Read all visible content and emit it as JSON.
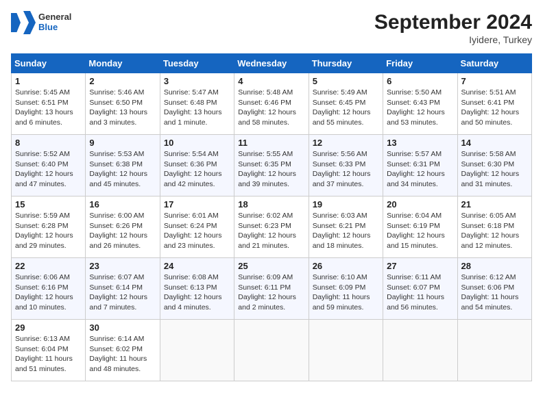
{
  "header": {
    "logo_general": "General",
    "logo_blue": "Blue",
    "month_title": "September 2024",
    "subtitle": "Iyidere, Turkey"
  },
  "weekdays": [
    "Sunday",
    "Monday",
    "Tuesday",
    "Wednesday",
    "Thursday",
    "Friday",
    "Saturday"
  ],
  "weeks": [
    [
      {
        "day": "1",
        "detail": "Sunrise: 5:45 AM\nSunset: 6:51 PM\nDaylight: 13 hours\nand 6 minutes."
      },
      {
        "day": "2",
        "detail": "Sunrise: 5:46 AM\nSunset: 6:50 PM\nDaylight: 13 hours\nand 3 minutes."
      },
      {
        "day": "3",
        "detail": "Sunrise: 5:47 AM\nSunset: 6:48 PM\nDaylight: 13 hours\nand 1 minute."
      },
      {
        "day": "4",
        "detail": "Sunrise: 5:48 AM\nSunset: 6:46 PM\nDaylight: 12 hours\nand 58 minutes."
      },
      {
        "day": "5",
        "detail": "Sunrise: 5:49 AM\nSunset: 6:45 PM\nDaylight: 12 hours\nand 55 minutes."
      },
      {
        "day": "6",
        "detail": "Sunrise: 5:50 AM\nSunset: 6:43 PM\nDaylight: 12 hours\nand 53 minutes."
      },
      {
        "day": "7",
        "detail": "Sunrise: 5:51 AM\nSunset: 6:41 PM\nDaylight: 12 hours\nand 50 minutes."
      }
    ],
    [
      {
        "day": "8",
        "detail": "Sunrise: 5:52 AM\nSunset: 6:40 PM\nDaylight: 12 hours\nand 47 minutes."
      },
      {
        "day": "9",
        "detail": "Sunrise: 5:53 AM\nSunset: 6:38 PM\nDaylight: 12 hours\nand 45 minutes."
      },
      {
        "day": "10",
        "detail": "Sunrise: 5:54 AM\nSunset: 6:36 PM\nDaylight: 12 hours\nand 42 minutes."
      },
      {
        "day": "11",
        "detail": "Sunrise: 5:55 AM\nSunset: 6:35 PM\nDaylight: 12 hours\nand 39 minutes."
      },
      {
        "day": "12",
        "detail": "Sunrise: 5:56 AM\nSunset: 6:33 PM\nDaylight: 12 hours\nand 37 minutes."
      },
      {
        "day": "13",
        "detail": "Sunrise: 5:57 AM\nSunset: 6:31 PM\nDaylight: 12 hours\nand 34 minutes."
      },
      {
        "day": "14",
        "detail": "Sunrise: 5:58 AM\nSunset: 6:30 PM\nDaylight: 12 hours\nand 31 minutes."
      }
    ],
    [
      {
        "day": "15",
        "detail": "Sunrise: 5:59 AM\nSunset: 6:28 PM\nDaylight: 12 hours\nand 29 minutes."
      },
      {
        "day": "16",
        "detail": "Sunrise: 6:00 AM\nSunset: 6:26 PM\nDaylight: 12 hours\nand 26 minutes."
      },
      {
        "day": "17",
        "detail": "Sunrise: 6:01 AM\nSunset: 6:24 PM\nDaylight: 12 hours\nand 23 minutes."
      },
      {
        "day": "18",
        "detail": "Sunrise: 6:02 AM\nSunset: 6:23 PM\nDaylight: 12 hours\nand 21 minutes."
      },
      {
        "day": "19",
        "detail": "Sunrise: 6:03 AM\nSunset: 6:21 PM\nDaylight: 12 hours\nand 18 minutes."
      },
      {
        "day": "20",
        "detail": "Sunrise: 6:04 AM\nSunset: 6:19 PM\nDaylight: 12 hours\nand 15 minutes."
      },
      {
        "day": "21",
        "detail": "Sunrise: 6:05 AM\nSunset: 6:18 PM\nDaylight: 12 hours\nand 12 minutes."
      }
    ],
    [
      {
        "day": "22",
        "detail": "Sunrise: 6:06 AM\nSunset: 6:16 PM\nDaylight: 12 hours\nand 10 minutes."
      },
      {
        "day": "23",
        "detail": "Sunrise: 6:07 AM\nSunset: 6:14 PM\nDaylight: 12 hours\nand 7 minutes."
      },
      {
        "day": "24",
        "detail": "Sunrise: 6:08 AM\nSunset: 6:13 PM\nDaylight: 12 hours\nand 4 minutes."
      },
      {
        "day": "25",
        "detail": "Sunrise: 6:09 AM\nSunset: 6:11 PM\nDaylight: 12 hours\nand 2 minutes."
      },
      {
        "day": "26",
        "detail": "Sunrise: 6:10 AM\nSunset: 6:09 PM\nDaylight: 11 hours\nand 59 minutes."
      },
      {
        "day": "27",
        "detail": "Sunrise: 6:11 AM\nSunset: 6:07 PM\nDaylight: 11 hours\nand 56 minutes."
      },
      {
        "day": "28",
        "detail": "Sunrise: 6:12 AM\nSunset: 6:06 PM\nDaylight: 11 hours\nand 54 minutes."
      }
    ],
    [
      {
        "day": "29",
        "detail": "Sunrise: 6:13 AM\nSunset: 6:04 PM\nDaylight: 11 hours\nand 51 minutes."
      },
      {
        "day": "30",
        "detail": "Sunrise: 6:14 AM\nSunset: 6:02 PM\nDaylight: 11 hours\nand 48 minutes."
      },
      {
        "day": "",
        "detail": ""
      },
      {
        "day": "",
        "detail": ""
      },
      {
        "day": "",
        "detail": ""
      },
      {
        "day": "",
        "detail": ""
      },
      {
        "day": "",
        "detail": ""
      }
    ]
  ]
}
